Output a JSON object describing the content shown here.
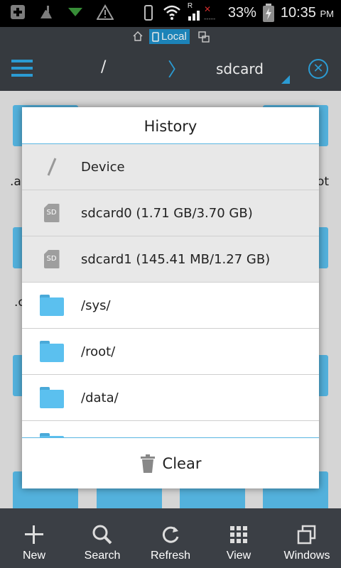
{
  "status": {
    "battery_pct": "33%",
    "time": "10:35",
    "ampm": "PM",
    "signal_tag": "R"
  },
  "subbar": {
    "location_label": "Local"
  },
  "topbar": {
    "root_label": "/",
    "title": "sdcard"
  },
  "background_labels": [
    ".a",
    "ot",
    ".c"
  ],
  "dialog": {
    "title": "History",
    "items": [
      {
        "label": "Device",
        "icon": "slash-icon"
      },
      {
        "label": "sdcard0 (1.71 GB/3.70 GB)",
        "icon": "sd-card-icon",
        "badge": "SD"
      },
      {
        "label": "sdcard1 (145.41 MB/1.27 GB)",
        "icon": "sd-card-icon",
        "badge": "SD"
      },
      {
        "label": "/sys/",
        "icon": "folder-icon"
      },
      {
        "label": "/root/",
        "icon": "folder-icon"
      },
      {
        "label": "/data/",
        "icon": "folder-icon"
      },
      {
        "label": "/",
        "icon": "folder-icon"
      }
    ],
    "clear_label": "Clear"
  },
  "toolbar": {
    "new": "New",
    "search": "Search",
    "refresh": "Refresh",
    "view": "View",
    "windows": "Windows"
  },
  "colors": {
    "accent": "#2fa9e5",
    "bar": "#3b3f45",
    "folder": "#5bc0ef"
  }
}
